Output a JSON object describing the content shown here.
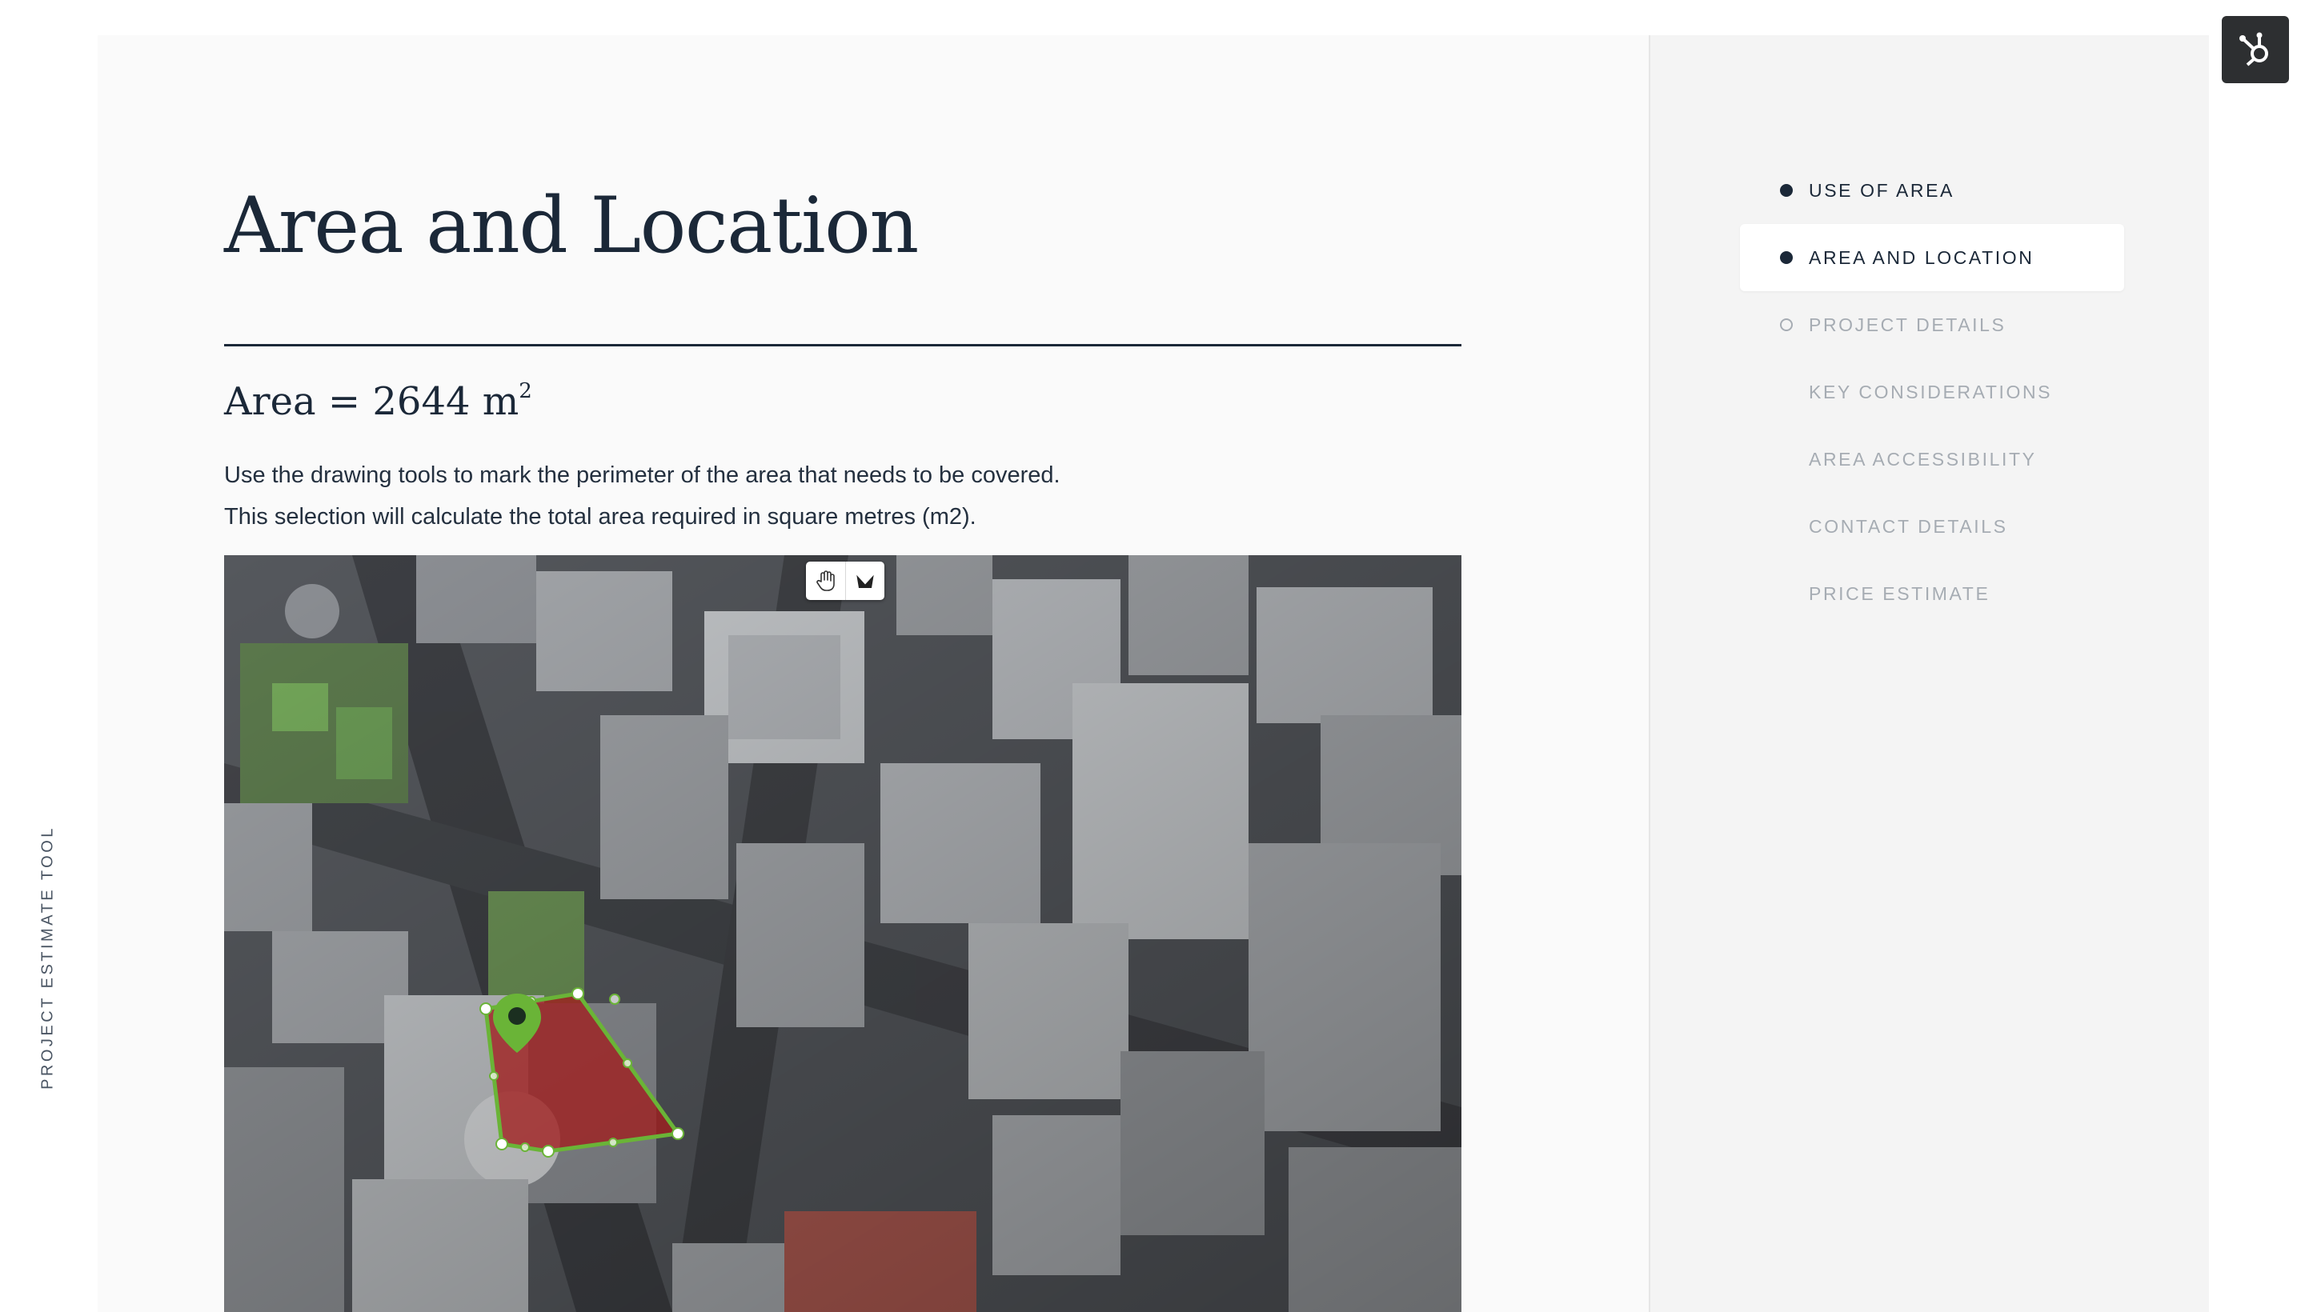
{
  "side_label": "PROJECT ESTIMATE TOOL",
  "main": {
    "title": "Area and Location",
    "area_label": "Area = 2644 m",
    "area_unit_sup": "2",
    "instructions": [
      "Use the drawing tools to mark the perimeter of the area that needs to be covered.",
      "This selection will calculate the total area required in square metres (m2)."
    ]
  },
  "map": {
    "tools": [
      {
        "icon": "hand-pan-icon",
        "name": "pan-tool"
      },
      {
        "icon": "polygon-draw-icon",
        "name": "draw-tool"
      }
    ],
    "polygon_stroke_color": "#6ab437",
    "polygon_fill_color": "#a01e1e",
    "marker_color": "#6ab437"
  },
  "steps": [
    {
      "label": "USE OF AREA",
      "state": "complete"
    },
    {
      "label": "AREA AND LOCATION",
      "state": "active"
    },
    {
      "label": "PROJECT DETAILS",
      "state": "upcoming"
    },
    {
      "label": "KEY CONSIDERATIONS",
      "state": "none"
    },
    {
      "label": "AREA ACCESSIBILITY",
      "state": "none"
    },
    {
      "label": "CONTACT DETAILS",
      "state": "none"
    },
    {
      "label": "PRICE ESTIMATE",
      "state": "none"
    }
  ],
  "chat_widget": {
    "icon": "hubspot-sprocket-icon"
  }
}
